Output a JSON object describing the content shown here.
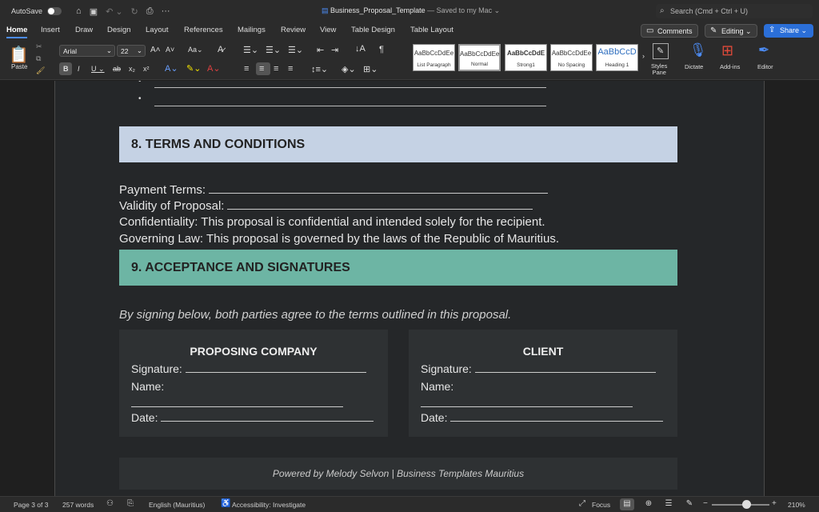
{
  "titlebar": {
    "autosave": "AutoSave",
    "doc_name": "Business_Proposal_Template",
    "saved_status": "— Saved to my Mac",
    "search_placeholder": "Search (Cmd + Ctrl + U)",
    "icons": [
      "home-icon",
      "save-icon",
      "undo-icon",
      "redo-icon",
      "print-icon",
      "more-icon"
    ]
  },
  "tabs": [
    "Home",
    "Insert",
    "Draw",
    "Design",
    "Layout",
    "References",
    "Mailings",
    "Review",
    "View",
    "Table Design",
    "Table Layout"
  ],
  "active_tab": "Home",
  "actions": {
    "comments": "Comments",
    "editing": "Editing",
    "share": "Share"
  },
  "ribbon": {
    "paste": "Paste",
    "font_name": "Arial",
    "font_size": "22",
    "styles": [
      {
        "sample": "AaBbCcDdEe",
        "name": "List Paragraph"
      },
      {
        "sample": "AaBbCcDdEe",
        "name": "Normal"
      },
      {
        "sample": "AaBbCcDdE",
        "name": "Strong1"
      },
      {
        "sample": "AaBbCcDdEe",
        "name": "No Spacing"
      },
      {
        "sample": "AaBbCcD",
        "name": "Heading 1"
      }
    ],
    "styles_pane": "Styles\nPane",
    "dictate": "Dictate",
    "addins": "Add-ins",
    "editor": "Editor"
  },
  "document": {
    "section8_title": "8.  TERMS AND CONDITIONS",
    "payment_terms": "Payment Terms:",
    "validity": "Validity of Proposal:",
    "confidentiality": "Confidentiality: This proposal is confidential and intended solely for the recipient.",
    "governing_law": "Governing Law: This proposal is governed by the laws of the Republic of Mauritius.",
    "section9_title": "9.  ACCEPTANCE AND SIGNATURES",
    "intro": "By signing below, both parties agree to the terms outlined in this proposal.",
    "proposer": {
      "title": "PROPOSING COMPANY",
      "signature": "Signature:",
      "name": "Name:",
      "date": "Date:"
    },
    "client": {
      "title": "CLIENT",
      "signature": "Signature:",
      "name": "Name:",
      "date": "Date:"
    },
    "footer": "Powered by Melody Selvon  |  Business Templates Mauritius"
  },
  "status": {
    "page": "Page 3 of 3",
    "words": "257 words",
    "language": "English (Mauritius)",
    "accessibility": "Accessibility: Investigate",
    "focus": "Focus",
    "zoom": "210%"
  },
  "colors": {
    "section8": "#c5d2e4",
    "section9": "#6db5a4",
    "accent": "#2b6fd8"
  }
}
